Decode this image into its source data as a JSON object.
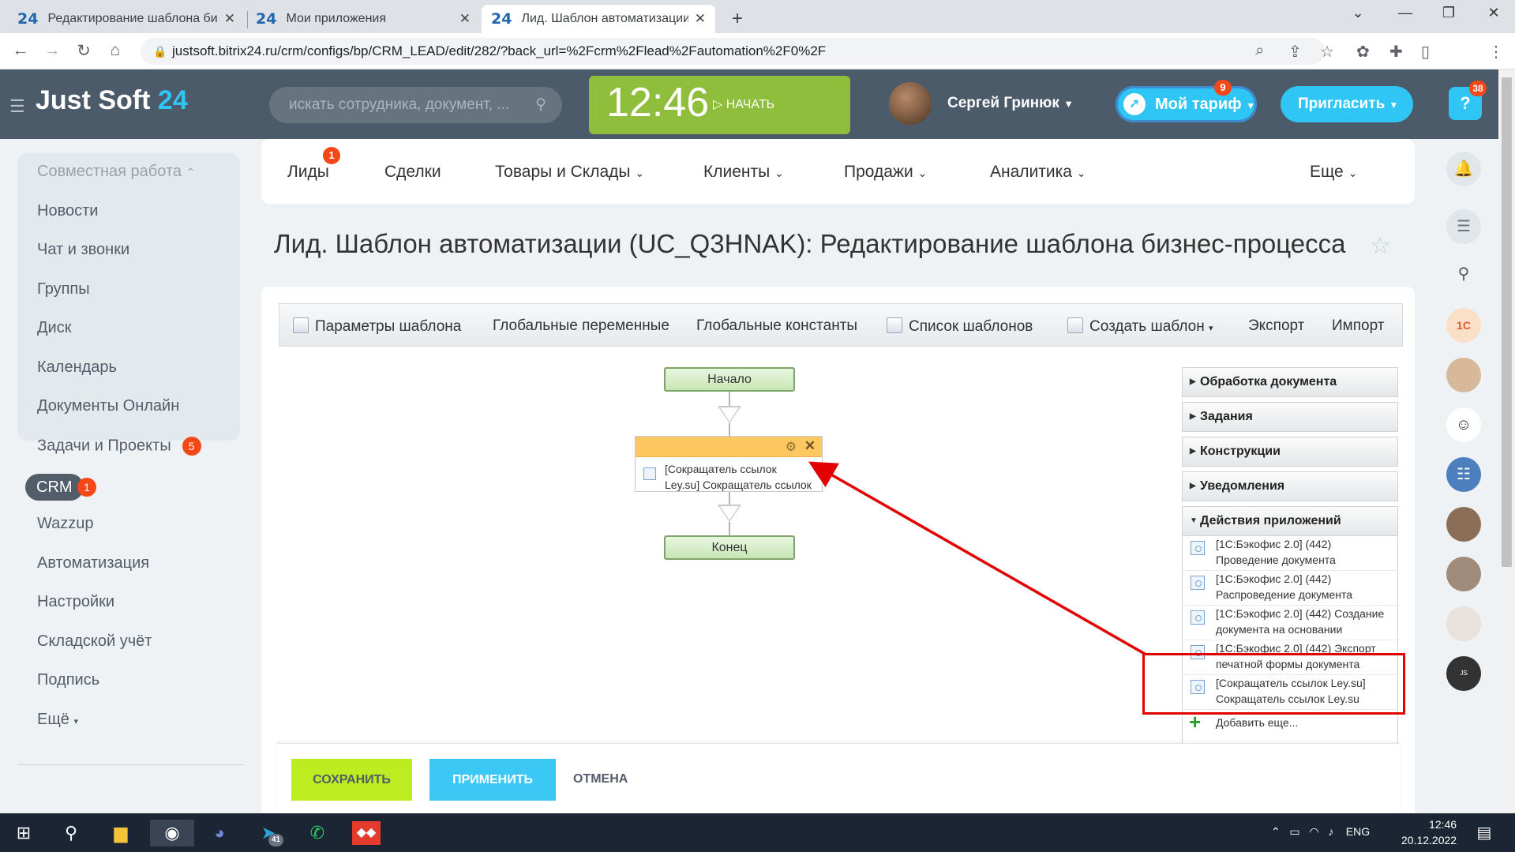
{
  "browser": {
    "tabs": [
      {
        "favicon": "24",
        "title": "Редактирование шаблона бизн"
      },
      {
        "favicon": "24",
        "title": "Мои приложения"
      },
      {
        "favicon": "24",
        "title": "Лид. Шаблон автоматизации (U"
      }
    ],
    "new_tab": "+",
    "url": "justsoft.bitrix24.ru/crm/configs/bp/CRM_LEAD/edit/282/?back_url=%2Fcrm%2Flead%2Fautomation%2F0%2F"
  },
  "header": {
    "logo_text": "Just Soft",
    "logo_num": "24",
    "search_placeholder": "искать сотрудника, документ, ...",
    "clock": "12:46",
    "start_label": "НАЧАТЬ",
    "user_name": "Сергей Гринюк",
    "tariff_label": "Мой тариф",
    "tariff_badge": "9",
    "invite_label": "Пригласить",
    "help_badge": "38"
  },
  "left_menu": {
    "group_title": "Совместная работа",
    "items": [
      "Новости",
      "Чат и звонки",
      "Группы",
      "Диск",
      "Календарь",
      "Документы Онлайн"
    ],
    "tasks_label": "Задачи и Проекты",
    "tasks_count": "5",
    "crm_label": "CRM",
    "crm_count": "1",
    "items2": [
      "Wazzup",
      "Автоматизация",
      "Настройки",
      "Складской учёт",
      "Подпись",
      "Ещё"
    ]
  },
  "top_nav": {
    "items": [
      "Лиды",
      "Сделки",
      "Товары и Склады",
      "Клиенты",
      "Продажи",
      "Аналитика",
      "Еще"
    ],
    "leads_badge": "1"
  },
  "page_title": "Лид. Шаблон автоматизации (UC_Q3HNAK): Редактирование шаблона бизнес-процесса",
  "toolbar": {
    "items": [
      "Параметры шаблона",
      "Глобальные переменные",
      "Глобальные константы",
      "Список шаблонов",
      "Создать шаблон",
      "Экспорт",
      "Импорт"
    ]
  },
  "diagram": {
    "start": "Начало",
    "end": "Конец",
    "activity_line1": "[Сокращатель ссылок",
    "activity_line2": "Ley.su] Сокращатель ссылок"
  },
  "palette": {
    "groups": [
      "Обработка документа",
      "Задания",
      "Конструкции",
      "Уведомления",
      "Действия приложений"
    ],
    "items": [
      {
        "l1": "[1С:Бэкофис 2.0] (442)",
        "l2": "Проведение документа"
      },
      {
        "l1": "[1С:Бэкофис 2.0] (442)",
        "l2": "Распроведение документа"
      },
      {
        "l1": "[1С:Бэкофис 2.0] (442) Создание",
        "l2": "документа на основании"
      },
      {
        "l1": "[1С:Бэкофис 2.0] (442) Экспорт",
        "l2": "печатной формы документа"
      },
      {
        "l1": "[Сокращатель ссылок Ley.su]",
        "l2": "Сокращатель ссылок Ley.su"
      }
    ],
    "add_more": "Добавить еще..."
  },
  "buttons": {
    "save": "СОХРАНИТЬ",
    "apply": "ПРИМЕНИТЬ",
    "cancel": "ОТМЕНА"
  },
  "taskbar": {
    "telegram_badge": "41",
    "lang": "ENG",
    "time": "12:46",
    "date": "20.12.2022"
  },
  "colors": {
    "header_bg": "#4b5b69",
    "accent": "#2fc6f6",
    "clock_bg": "#8fbd3c",
    "save_bg": "#bbed21",
    "annotation_red": "#e30000"
  }
}
